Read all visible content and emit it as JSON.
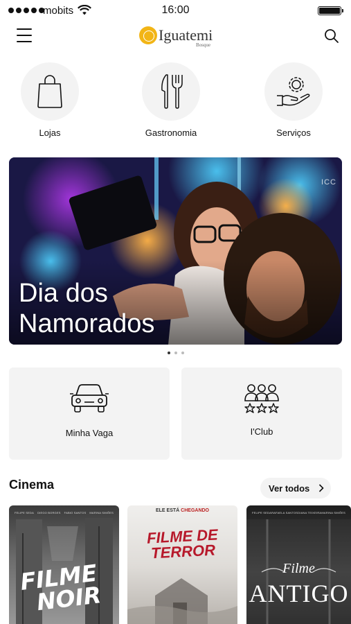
{
  "status": {
    "carrier": "mobits",
    "time": "16:00",
    "battery_level": 1.0
  },
  "header": {
    "logo_text": "Iguatemi",
    "logo_sub": "Bosque",
    "menu_icon": "hamburger-icon",
    "search_icon": "search-icon"
  },
  "categories": [
    {
      "label": "Lojas",
      "icon": "shopping-bag-icon"
    },
    {
      "label": "Gastronomia",
      "icon": "fork-knife-icon"
    },
    {
      "label": "Serviços",
      "icon": "gear-hand-icon"
    }
  ],
  "banner": {
    "line1": "Dia dos",
    "line2": "Namorados",
    "watermark": "ICC",
    "slides": 3,
    "active_slide": 1
  },
  "quick_actions": [
    {
      "label": "Minha Vaga",
      "icon": "car-icon"
    },
    {
      "label": "I'Club",
      "icon": "people-stars-icon"
    }
  ],
  "cinema": {
    "title": "Cinema",
    "see_all": "Ver todos",
    "posters": [
      {
        "title_line1": "FILME",
        "title_line2": "NOIR",
        "credits": [
          "FELIPE SEDA",
          "DIEGO BORGES",
          "FABIO SANTOS",
          "MARINA SIMÕES"
        ]
      },
      {
        "tagline_pre": "ELE ESTÁ",
        "tagline_highlight": "CHEGANDO",
        "title_line1": "FILME DE",
        "title_line2": "TERROR"
      },
      {
        "title_line1": "Filme",
        "title_line2": "ANTIGO",
        "credits": [
          "FELIPE SEDA",
          "RAFAELA SANTOS",
          "DIANA TEIXEIRA",
          "MARINA SIMÕES"
        ]
      }
    ]
  },
  "colors": {
    "brand_yellow": "#f2b516",
    "card_bg": "#f3f3f3",
    "terror_red": "#b7192b"
  }
}
